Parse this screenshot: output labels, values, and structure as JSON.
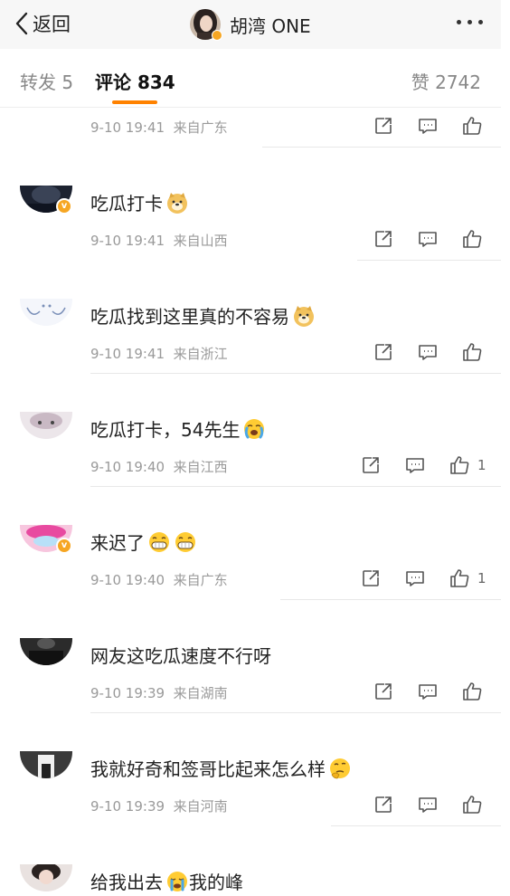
{
  "header": {
    "back_label": "返回",
    "title": "胡湾 ONE"
  },
  "tabs": [
    {
      "label": "转发 5"
    },
    {
      "label": "评论 834"
    },
    {
      "label": "赞 2742"
    }
  ],
  "comments": [
    {
      "time": "9-10 19:41",
      "source": "来自广东"
    },
    {
      "text": "吃瓜打卡",
      "emoji": "doge",
      "time": "9-10 19:41",
      "source": "来自山西",
      "verified": true
    },
    {
      "text": "吃瓜找到这里真的不容易",
      "emoji": "doge",
      "time": "9-10 19:41",
      "source": "来自浙江"
    },
    {
      "text": "吃瓜打卡，54先生",
      "emoji": "sob",
      "time": "9-10 19:40",
      "source": "来自江西",
      "likes": "1"
    },
    {
      "text": "来迟了",
      "emoji": "grin-grin",
      "time": "9-10 19:40",
      "source": "来自广东",
      "likes": "1",
      "verified": true
    },
    {
      "text": "网友这吃瓜速度不行呀",
      "time": "9-10 19:39",
      "source": "来自湖南"
    },
    {
      "text": "我就好奇和签哥比起来怎么样",
      "emoji": "thinking",
      "time": "9-10 19:39",
      "source": "来自河南"
    },
    {
      "text1": "给我出去",
      "emoji": "crying",
      "text2": "我的峰"
    }
  ],
  "colors": {
    "accent": "#ff8200",
    "verified": "#f6a623",
    "meta": "#9a9a9a"
  }
}
